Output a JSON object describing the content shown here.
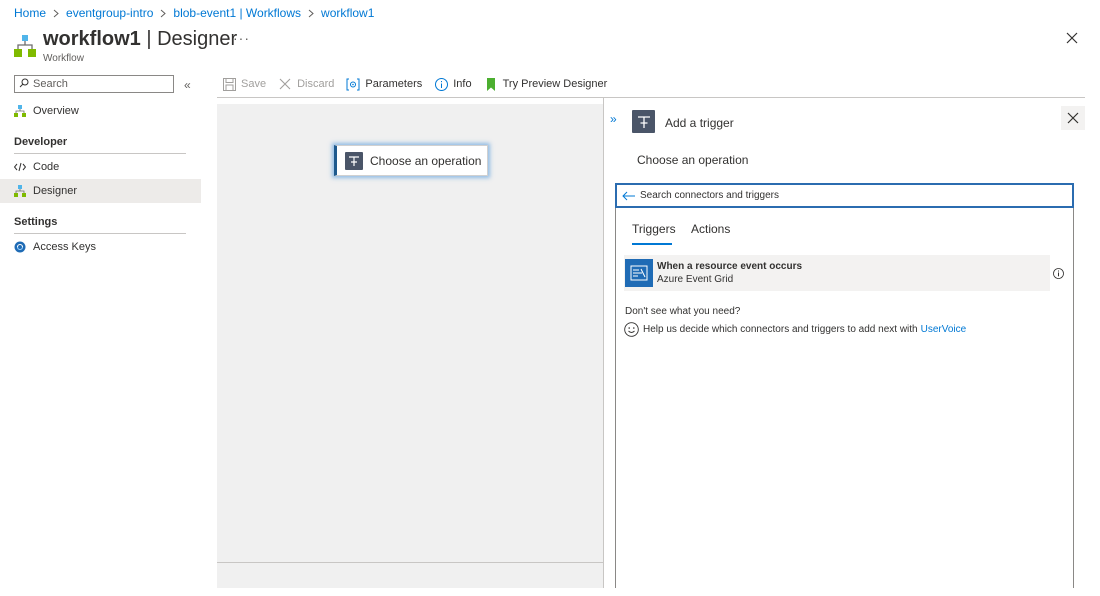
{
  "breadcrumb": {
    "items": [
      "Home",
      "eventgroup-intro",
      "blob-event1 | Workflows",
      "workflow1"
    ]
  },
  "header": {
    "title_main": "workflow1",
    "title_rest": " | Designer",
    "subtitle": "Workflow",
    "more": "···"
  },
  "nav": {
    "search_placeholder": "Search",
    "collapse": "«",
    "overview": "Overview",
    "developer_section": "Developer",
    "code": "Code",
    "designer": "Designer",
    "settings_section": "Settings",
    "access_keys": "Access Keys"
  },
  "toolbar": {
    "save": "Save",
    "discard": "Discard",
    "parameters": "Parameters",
    "info": "Info",
    "try_preview": "Try Preview Designer"
  },
  "canvas": {
    "card_label": "Choose an operation"
  },
  "panel": {
    "expand": "»",
    "title": "Add a trigger",
    "subtitle": "Choose an operation",
    "search_placeholder": "Search connectors and triggers",
    "tabs": [
      "Triggers",
      "Actions"
    ],
    "result": {
      "title": "When a resource event occurs",
      "connector": "Azure Event Grid"
    },
    "dont_see": "Don't see what you need?",
    "help_text": "Help us decide which connectors and triggers to add next with",
    "help_link": "UserVoice"
  },
  "colors": {
    "accent": "#0078d4",
    "canvas_bg": "#f0f0f0",
    "selected_nav_bg": "#edebe9",
    "event_grid_icon": "#1f6bb5"
  }
}
